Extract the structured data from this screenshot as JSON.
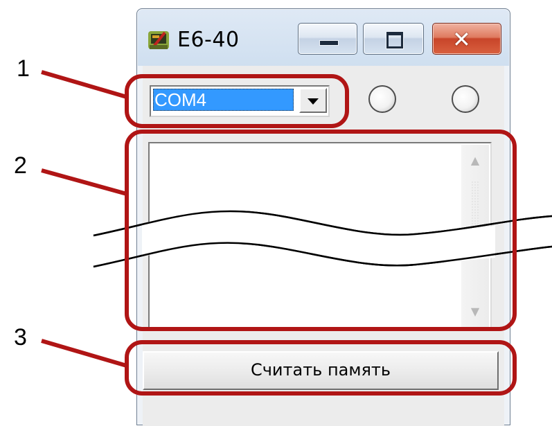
{
  "window": {
    "title": "E6-40",
    "app_icon": "app-icon",
    "caption_buttons": [
      "minimize-icon",
      "maximize-icon",
      "close-icon"
    ]
  },
  "port_select": {
    "value": "COM4",
    "icon": "chevron-down-icon"
  },
  "indicators": [
    {
      "name": "indicator-1",
      "checked": false
    },
    {
      "name": "indicator-2",
      "checked": false
    }
  ],
  "data_list": {
    "items": [],
    "scrollbar": {
      "up_icon": "scroll-up-icon",
      "down_icon": "scroll-down-icon"
    }
  },
  "read_button": {
    "label": "Считать память"
  },
  "annotations": {
    "callout_1": "1",
    "callout_2": "2",
    "callout_3": "3",
    "color": "#b01515"
  },
  "colors": {
    "selection": "#3399ff",
    "close_button": "#c8452a",
    "window_frame": "#cfdff0"
  }
}
